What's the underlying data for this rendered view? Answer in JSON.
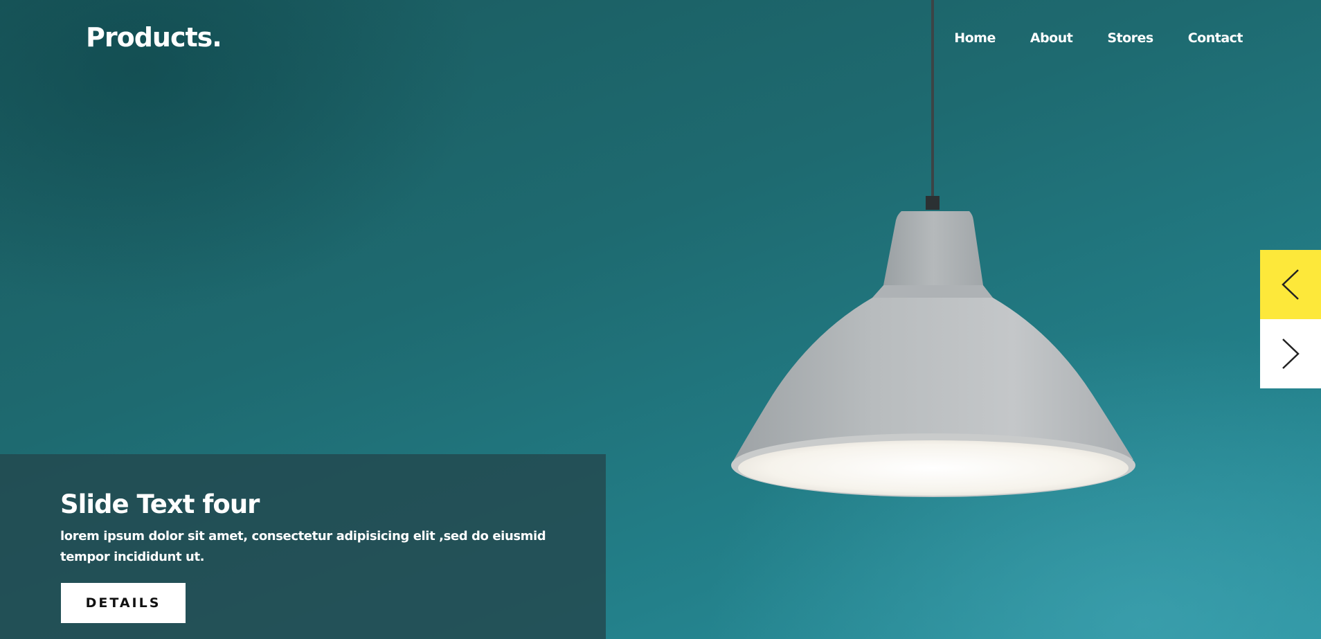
{
  "brand": {
    "logo_text": "Products."
  },
  "nav": {
    "items": [
      {
        "label": "Home"
      },
      {
        "label": "About"
      },
      {
        "label": "Stores"
      },
      {
        "label": "Contact"
      }
    ]
  },
  "slide": {
    "title": "Slide Text four",
    "text": "lorem ipsum dolor sit amet, consectetur adipisicing elit ,sed do eiusmid tempor incididunt ut.",
    "button_label": "DETAILS"
  },
  "slider_controls": {
    "prev_icon": "chevron-left-icon",
    "next_icon": "chevron-right-icon"
  },
  "colors": {
    "background": "#1e6a70",
    "accent": "#fde83a",
    "caption_panel": "#23484e",
    "text": "#ffffff"
  }
}
